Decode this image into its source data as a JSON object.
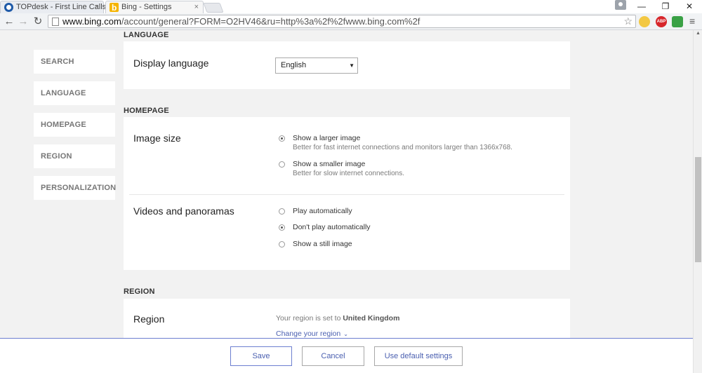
{
  "browser": {
    "tabs": [
      {
        "title": "TOPdesk - First Line Calls",
        "close": "×"
      },
      {
        "title": "Bing - Settings",
        "close": "×"
      }
    ],
    "window_controls": {
      "minimize": "—",
      "restore": "❐",
      "close": "✕"
    },
    "nav": {
      "back": "←",
      "forward": "→",
      "reload": "↻"
    },
    "url_host": "www.bing.com",
    "url_rest": "/account/general?FORM=O2HV46&ru=http%3a%2f%2fwww.bing.com%2f",
    "star": "☆",
    "abp_label": "ABP",
    "menu": "≡"
  },
  "sidebar": {
    "items": [
      {
        "label": "SEARCH"
      },
      {
        "label": "LANGUAGE"
      },
      {
        "label": "HOMEPAGE"
      },
      {
        "label": "REGION"
      },
      {
        "label": "PERSONALIZATION"
      }
    ]
  },
  "language": {
    "section_title": "LANGUAGE",
    "display_language_label": "Display language",
    "selected": "English",
    "arrow": "▼"
  },
  "homepage": {
    "section_title": "HOMEPAGE",
    "image_size": {
      "label": "Image size",
      "options": [
        {
          "label": "Show a larger image",
          "desc": "Better for fast internet connections and monitors larger than 1366x768.",
          "checked": true
        },
        {
          "label": "Show a smaller image",
          "desc": "Better for slow internet connections.",
          "checked": false
        }
      ]
    },
    "videos": {
      "label": "Videos and panoramas",
      "options": [
        {
          "label": "Play automatically",
          "checked": false
        },
        {
          "label": "Don't play automatically",
          "checked": true
        },
        {
          "label": "Show a still image",
          "checked": false
        }
      ]
    }
  },
  "region": {
    "section_title": "REGION",
    "label": "Region",
    "text_prefix": "Your region is set to",
    "value": "United Kingdom",
    "change_link": "Change your region",
    "chevron": "⌄"
  },
  "footer": {
    "save": "Save",
    "cancel": "Cancel",
    "default": "Use default settings"
  }
}
